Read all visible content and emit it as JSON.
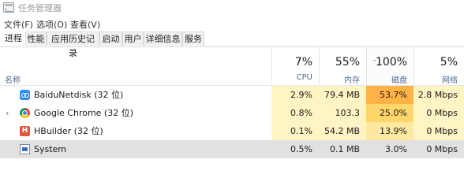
{
  "window": {
    "title": "任务管理器"
  },
  "menu": [
    "文件(F)",
    "选项(O)",
    "查看(V)"
  ],
  "tabs": [
    {
      "label": "进程",
      "active": true
    },
    {
      "label": "性能",
      "active": false
    },
    {
      "label": "应用历史记录",
      "active": false
    },
    {
      "label": "启动",
      "active": false
    },
    {
      "label": "用户",
      "active": false
    },
    {
      "label": "详细信息",
      "active": false
    },
    {
      "label": "服务",
      "active": false
    }
  ],
  "columns": {
    "name": {
      "label": "名称"
    },
    "cpu": {
      "pct": "7%",
      "label": "CPU"
    },
    "memory": {
      "pct": "55%",
      "label": "内存"
    },
    "disk": {
      "pct": "100%",
      "label": "磁盘",
      "sorted": "descending"
    },
    "network": {
      "pct": "5%",
      "label": "网络"
    }
  },
  "processes": [
    {
      "name": "BaiduNetdisk (32 位)",
      "icon": "baidu-netdisk-icon",
      "expandable": false,
      "cpu": "2.9%",
      "memory": "79.4 MB",
      "disk": "53.7%",
      "network": "2.8 Mbps",
      "selected": false
    },
    {
      "name": "Google Chrome (32 位)",
      "icon": "chrome-icon",
      "expandable": true,
      "cpu": "0.8%",
      "memory": "103.3 MB",
      "disk": "25.0%",
      "network": "0 Mbps",
      "selected": false
    },
    {
      "name": "HBuilder (32 位)",
      "icon": "hbuilder-icon",
      "expandable": false,
      "cpu": "0.1%",
      "memory": "54.2 MB",
      "disk": "13.9%",
      "network": "0 Mbps",
      "selected": false
    },
    {
      "name": "System",
      "icon": "system-icon",
      "expandable": false,
      "cpu": "0.5%",
      "memory": "0.1 MB",
      "disk": "3.0%",
      "network": "0 Mbps",
      "selected": true
    }
  ],
  "colors": {
    "heat_light": "#fff4c4",
    "heat_mid": "#ffe9a0",
    "heat_strong": "#ffd66b",
    "heat_hot": "#ffb347",
    "selected_row": "#e1e1e1",
    "column_label": "#4d6a8f"
  }
}
